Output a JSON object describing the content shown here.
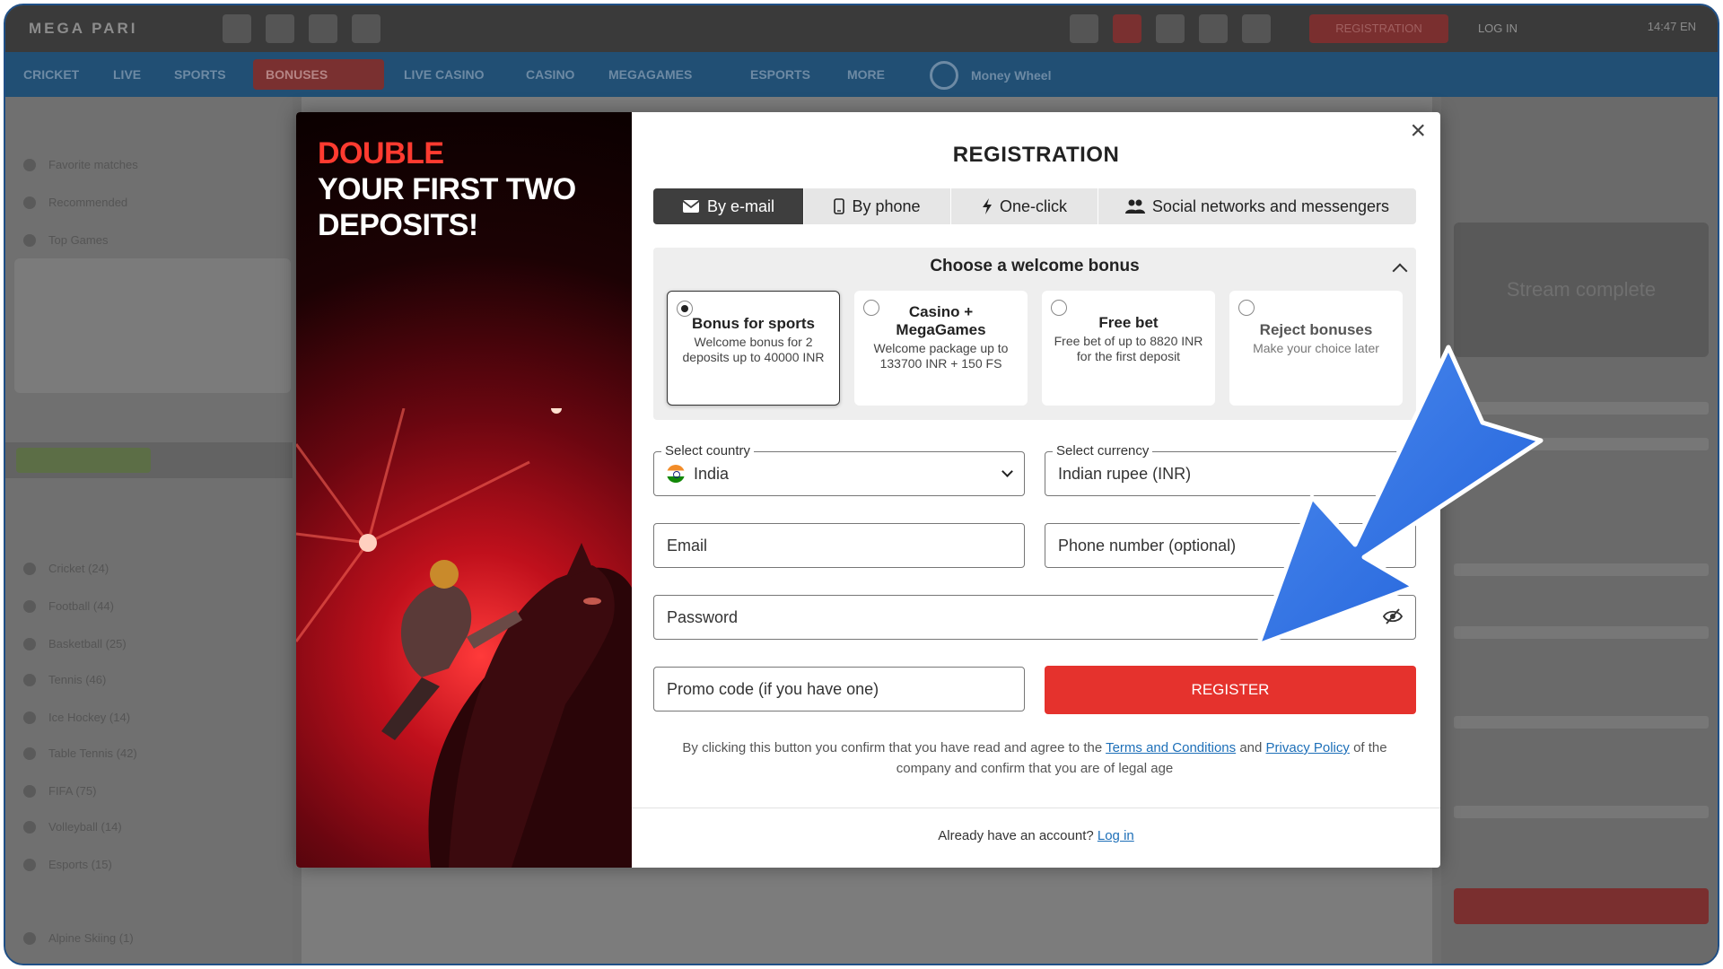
{
  "background": {
    "logo": "MEGA PARI",
    "top": {
      "register": "REGISTRATION",
      "login": "LOG IN",
      "right_info": "14:47  EN"
    },
    "nav": [
      "CRICKET",
      "LIVE",
      "SPORTS",
      "BONUSES",
      "LIVE CASINO",
      "CASINO",
      "MEGAGAMES",
      "ESPORTS",
      "MORE"
    ],
    "nav_wheel": "Money Wheel",
    "left_items": [
      "Favorite matches",
      "Recommended",
      "Top Games",
      "Cricket (24)",
      "Football (44)",
      "Basketball (25)",
      "Tennis (46)",
      "Ice Hockey (14)",
      "Table Tennis (42)",
      "FIFA (75)",
      "Volleyball (14)",
      "Esports (15)",
      "Alpine Skiing (1)"
    ],
    "stream_text": "Stream complete"
  },
  "promo": {
    "line1": "DOUBLE",
    "line2": "YOUR FIRST TWO",
    "line3": "DEPOSITS!"
  },
  "modal": {
    "title": "REGISTRATION",
    "close": "×",
    "tabs": [
      {
        "label": "By e-mail",
        "icon": "envelope-icon",
        "active": true
      },
      {
        "label": "By phone",
        "icon": "phone-icon",
        "active": false
      },
      {
        "label": "One-click",
        "icon": "lightning-icon",
        "active": false
      },
      {
        "label": "Social networks and messengers",
        "icon": "users-icon",
        "active": false
      }
    ],
    "bonus": {
      "heading": "Choose a welcome bonus",
      "options": [
        {
          "title": "Bonus for sports",
          "desc": "Welcome bonus for 2 deposits up to 40000 INR",
          "selected": true
        },
        {
          "title": "Casino + MegaGames",
          "desc": "Welcome package up to 133700 INR + 150 FS",
          "selected": false
        },
        {
          "title": "Free bet",
          "desc": "Free bet of up to 8820 INR for the first deposit",
          "selected": false
        },
        {
          "title": "Reject bonuses",
          "desc": "Make your choice later",
          "selected": false
        }
      ]
    },
    "country": {
      "label": "Select country",
      "value": "India"
    },
    "currency": {
      "label": "Select currency",
      "value": "Indian rupee (INR)"
    },
    "email": {
      "placeholder": "Email"
    },
    "phone": {
      "placeholder": "Phone number (optional)"
    },
    "password": {
      "placeholder": "Password"
    },
    "promo_code": {
      "placeholder": "Promo code (if you have one)"
    },
    "register_button": "REGISTER",
    "legal": {
      "part1": "By clicking this button you confirm that you have read and agree to the",
      "terms": "Terms and Conditions",
      "and": "and",
      "privacy": "Privacy Policy",
      "part2": "of the company and confirm that you are of legal age"
    },
    "account": {
      "text": "Already have an account?",
      "login": "Log in"
    }
  },
  "colors": {
    "accent_red": "#e5322d",
    "promo_red": "#ff3b30",
    "arrow_blue": "#2f6fe4",
    "nav_blue": "#214f74"
  }
}
